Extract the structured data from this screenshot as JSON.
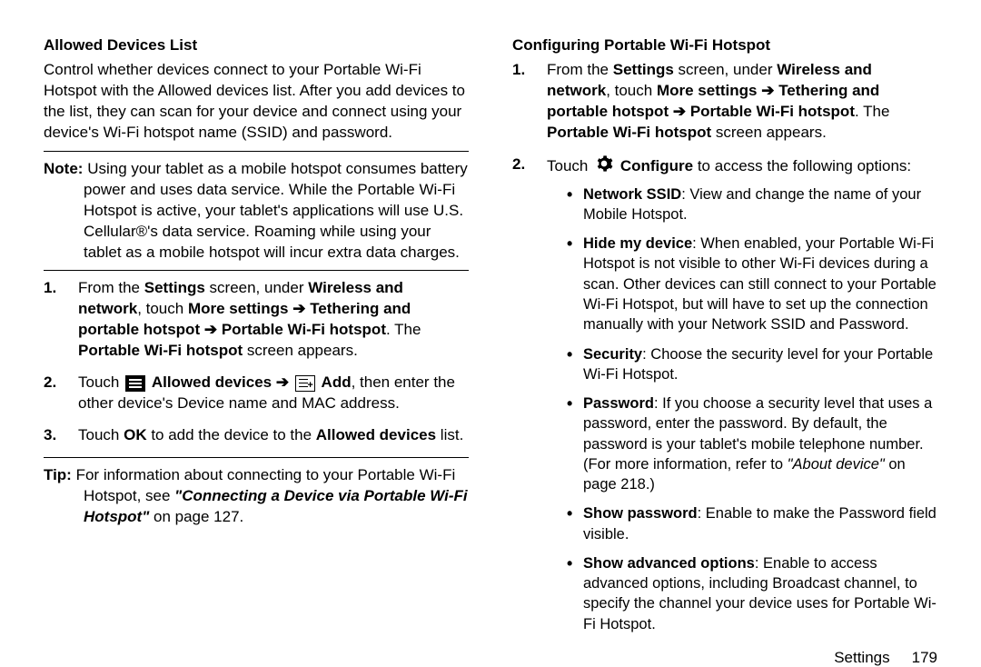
{
  "left": {
    "h1": "Allowed Devices List",
    "intro": "Control whether devices connect to your Portable Wi-Fi Hotspot with the Allowed devices list. After you add devices to the list, they can scan for your device and connect using your device's Wi-Fi hotspot name (SSID) and password.",
    "noteLabel": "Note:",
    "noteBody": "Using your tablet as a mobile hotspot consumes battery power and uses data service. While the Portable Wi-Fi Hotspot is active, your tablet's applications will use U.S. Cellular®'s data service. Roaming while using your tablet as a mobile hotspot will incur extra data charges.",
    "s1": {
      "num": "1.",
      "a": "From the ",
      "b1": "Settings",
      "b": " screen, under ",
      "b2": "Wireless and network",
      "c": ", touch ",
      "b3": "More settings",
      "arr": " ➔ ",
      "b4": "Tethering and portable hotspot",
      "b5": "Portable Wi-Fi hotspot",
      "d": ". The ",
      "b6": "Portable Wi-Fi hotspot",
      "e": " screen appears."
    },
    "s2": {
      "num": "2.",
      "a": "Touch ",
      "b1": "Allowed devices",
      "arr": " ➔ ",
      "b2": "Add",
      "b": ", then enter the other device's Device name and MAC address."
    },
    "s3": {
      "num": "3.",
      "a": "Touch ",
      "b1": "OK",
      "b": " to add the device to the ",
      "b2": "Allowed devices",
      "c": " list."
    },
    "tipLabel": "Tip:",
    "tipA": "For information about connecting to your Portable Wi-Fi Hotspot, see ",
    "tipBI": "\"Connecting a Device via Portable Wi-Fi Hotspot\"",
    "tipB": " on page 127."
  },
  "right": {
    "h1": "Configuring Portable Wi-Fi Hotspot",
    "s1": {
      "num": "1.",
      "a": "From the ",
      "b1": "Settings",
      "b": " screen, under ",
      "b2": "Wireless and network",
      "c": ", touch ",
      "b3": "More settings",
      "arr": " ➔ ",
      "b4": "Tethering and portable hotspot",
      "b5": "Portable Wi-Fi hotspot",
      "d": ". The ",
      "b6": "Portable Wi-Fi hotspot",
      "e": " screen appears."
    },
    "s2": {
      "num": "2.",
      "a": "Touch ",
      "b1": "Configure",
      "b": " to access the following options:"
    },
    "bul": {
      "ssid": {
        "b": "Network SSID",
        "t": ": View and change the name of your Mobile Hotspot."
      },
      "hide": {
        "b": "Hide my device",
        "t": ": When enabled, your Portable Wi-Fi Hotspot is not visible to other Wi-Fi devices during a scan. Other devices can still connect to your Portable Wi-Fi Hotspot, but  will have to set up the connection manually with your Network SSID and Password."
      },
      "sec": {
        "b": "Security",
        "t": ": Choose the security level for your Portable Wi-Fi Hotspot."
      },
      "pwd": {
        "b": "Password",
        "t1": ": If you choose a security level that uses a password, enter the password. By default, the password is your tablet's mobile telephone number. (For more information, refer to ",
        "iref": "\"About device\"",
        "t2": " on page 218.)"
      },
      "show": {
        "b": "Show password",
        "t": ": Enable to make the Password field visible."
      },
      "adv": {
        "b": "Show advanced options",
        "t": ": Enable to access advanced options, including Broadcast channel, to specify the channel your device uses for Portable Wi-Fi Hotspot."
      }
    }
  },
  "footer": {
    "section": "Settings",
    "page": "179"
  }
}
